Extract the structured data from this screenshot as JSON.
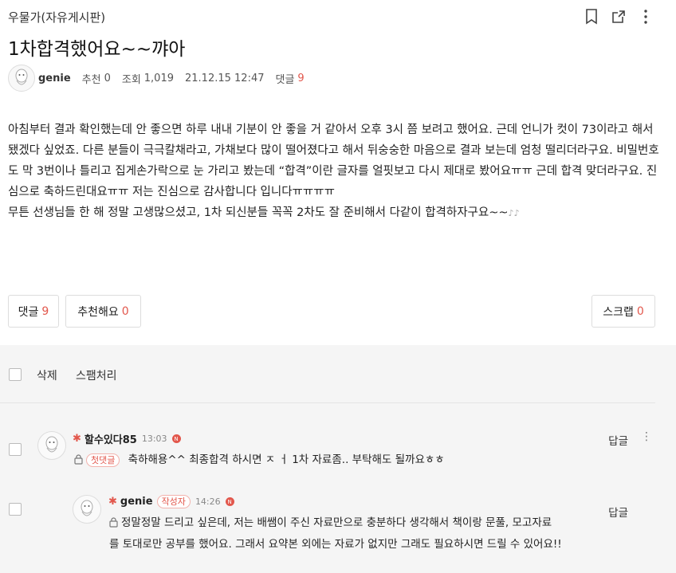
{
  "cafe_name": "우물가(자유게시판)",
  "post": {
    "title": "1차합격했어요~~꺄아",
    "author": "genie",
    "recommend_label": "추천",
    "recommend_count": "0",
    "views_label": "조회",
    "views": "1,019",
    "date": "21.12.15 12:47",
    "comments_label": "댓글",
    "comments_count": "9",
    "body": [
      "아침부터 결과 확인했는데 안 좋으면 하루 내내 기분이 안 좋을 거 같아서 오후 3시 쯤 보려고 했어요. 근데  언니가 컷이 73이라고 해서 됐겠다 싶었죠. 다른 분들이 극극칼채라고, 가채보다 많이 떨어졌다고 해서 뒤숭숭한 마음으로 결과 보는데 엄청 떨리더라구요. 비밀번호도 막 3번이나 틀리고 집게손가락으로 눈 가리고 봤는데 “합격”이란 글자를 얼핏보고 다시 제대로 봤어요ㅠㅠ 근데 합격 맞더라구요. 진심으로 축하드린대요ㅠㅠ 저는 진심으로 감사합니다 입니다ㅠㅠㅠㅠ",
      "무튼 선생님들 한 해 정말 고생많으셨고, 1차 되신분들 꼭꼭 2차도 잘 준비해서 다같이 합격하자구요~~"
    ]
  },
  "buttons": {
    "comment_label": "댓글",
    "comment_count": "9",
    "recommend_label": "추천해요",
    "recommend_count": "0",
    "scrap_label": "스크랩",
    "scrap_count": "0"
  },
  "toolbar": {
    "delete_label": "삭제",
    "spam_label": "스팸처리"
  },
  "comments": [
    {
      "nick": "할수있다85",
      "time": "13:03",
      "tag": "첫댓글",
      "text": "축하해용^^ 최종합격 하시면 ㅈ ㅓ 1차 자료좀.. 부탁해도 될까요ㅎㅎ",
      "reply_label": "답글"
    },
    {
      "nick": "genie",
      "time": "14:26",
      "tag": "작성자",
      "text_line1": "정말정말 드리고 싶은데, 저는 배쌤이 주신 자료만으로 충분하다 생각해서 책이랑 문풀, 모고자료",
      "text_line2": "를 토대로만 공부를 했어요. 그래서 요약본 외에는 자료가 없지만 그래도 필요하시면 드릴 수 있어요!!",
      "reply_label": "답글"
    }
  ],
  "badge_letter": "N",
  "colors": {
    "accent": "#e2574c",
    "comment_bg": "#f5f5f5"
  },
  "icons": [
    "bookmark-icon",
    "share-icon",
    "more-vertical-icon",
    "lock-icon",
    "crab-icon",
    "profile-avatar-icon"
  ]
}
